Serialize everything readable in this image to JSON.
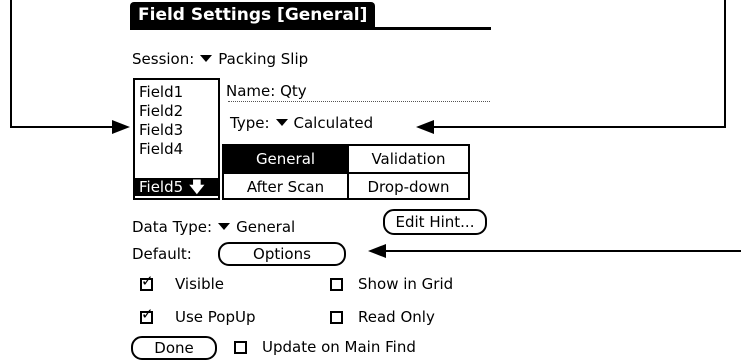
{
  "title": "Field Settings [General]",
  "session": {
    "label": "Session:",
    "value": "Packing Slip"
  },
  "fields": [
    "Field1",
    "Field2",
    "Field3",
    "Field4",
    "Field5"
  ],
  "selected_field_index": 4,
  "name_line": "Name: Qty",
  "type": {
    "label": "Type:",
    "value": "Calculated"
  },
  "tabs": {
    "general": "General",
    "validation": "Validation",
    "after_scan": "After Scan",
    "dropdown": "Drop-down"
  },
  "data_type": {
    "label": "Data Type:",
    "value": "General"
  },
  "edit_hint_button": "Edit Hint...",
  "default": {
    "label": "Default:",
    "button": "Options"
  },
  "checkboxes": {
    "visible": {
      "label": "Visible",
      "checked": true
    },
    "show_in_grid": {
      "label": "Show in Grid",
      "checked": false
    },
    "use_popup": {
      "label": "Use PopUp",
      "checked": true
    },
    "read_only": {
      "label": "Read Only",
      "checked": false
    },
    "update_on_main_find": {
      "label": "Update on Main Find",
      "checked": false
    }
  },
  "done_button": "Done"
}
